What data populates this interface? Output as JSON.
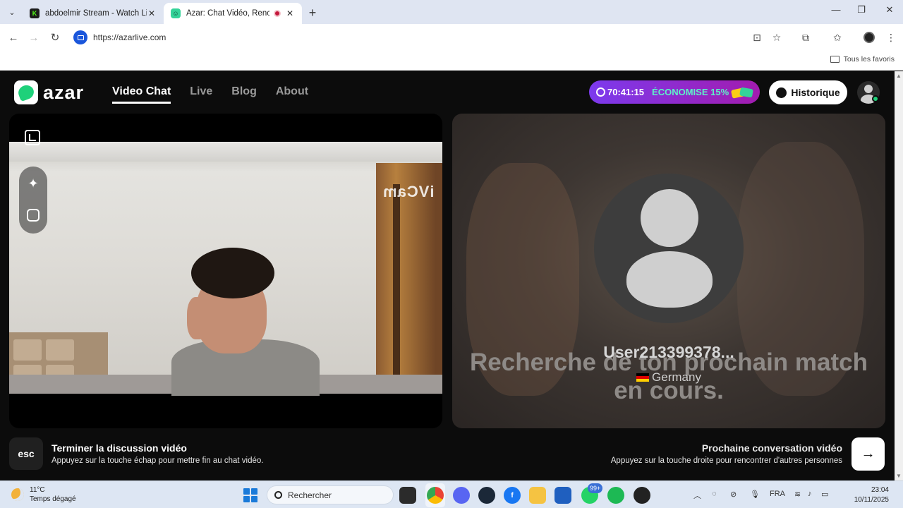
{
  "browser": {
    "tabs": [
      {
        "title": "abdoelmir Stream - Watch Live"
      },
      {
        "title": "Azar: Chat Vidéo, Rencontre"
      }
    ],
    "url": "https://azarlive.com",
    "bookmarks_label": "Tous les favoris"
  },
  "site": {
    "logo_text": "azar",
    "nav": [
      {
        "label": "Video Chat",
        "active": true
      },
      {
        "label": "Live"
      },
      {
        "label": "Blog"
      },
      {
        "label": "About"
      }
    ],
    "promo": {
      "timer": "70:41:15",
      "text": "ÉCONOMISE 15%"
    },
    "history_label": "Historique"
  },
  "local_video": {
    "watermark": "iVCam"
  },
  "remote_video": {
    "status": "Recherche de ton prochain match en cours.",
    "username": "User213399378...",
    "country": "Germany"
  },
  "hints": {
    "end_key": "esc",
    "end_title": "Terminer la discussion vidéo",
    "end_sub": "Appuyez sur la touche échap pour mettre fin au chat vidéo.",
    "next_title": "Prochaine conversation vidéo",
    "next_sub": "Appuyez sur la touche droite pour rencontrer d'autres personnes",
    "next_key": "→"
  },
  "taskbar": {
    "weather_temp": "11°C",
    "weather_desc": "Temps dégagé",
    "search_placeholder": "Rechercher",
    "whatsapp_badge": "99+",
    "language": "FRA",
    "time": "23:04",
    "date": "10/11/2025"
  }
}
